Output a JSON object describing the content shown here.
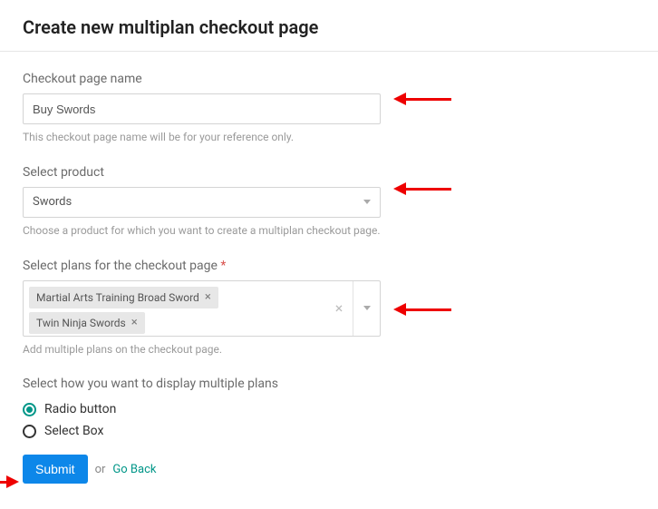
{
  "page_title": "Create new multiplan checkout page",
  "fields": {
    "name": {
      "label": "Checkout page name",
      "value": "Buy Swords",
      "help": "This checkout page name will be for your reference only."
    },
    "product": {
      "label": "Select product",
      "selected": "Swords",
      "help": "Choose a product for which you want to create a multiplan checkout page."
    },
    "plans": {
      "label": "Select plans for the checkout page",
      "required_marker": "*",
      "tags": [
        {
          "label": "Martial Arts Training Broad Sword"
        },
        {
          "label": "Twin Ninja Swords"
        }
      ],
      "help": "Add multiple plans on the checkout page."
    },
    "display": {
      "label": "Select how you want to display multiple plans",
      "options": [
        {
          "label": "Radio button",
          "checked": true
        },
        {
          "label": "Select Box",
          "checked": false
        }
      ]
    }
  },
  "actions": {
    "submit": "Submit",
    "or": "or",
    "go_back": "Go Back"
  },
  "icons": {
    "remove": "×",
    "clear": "×"
  }
}
